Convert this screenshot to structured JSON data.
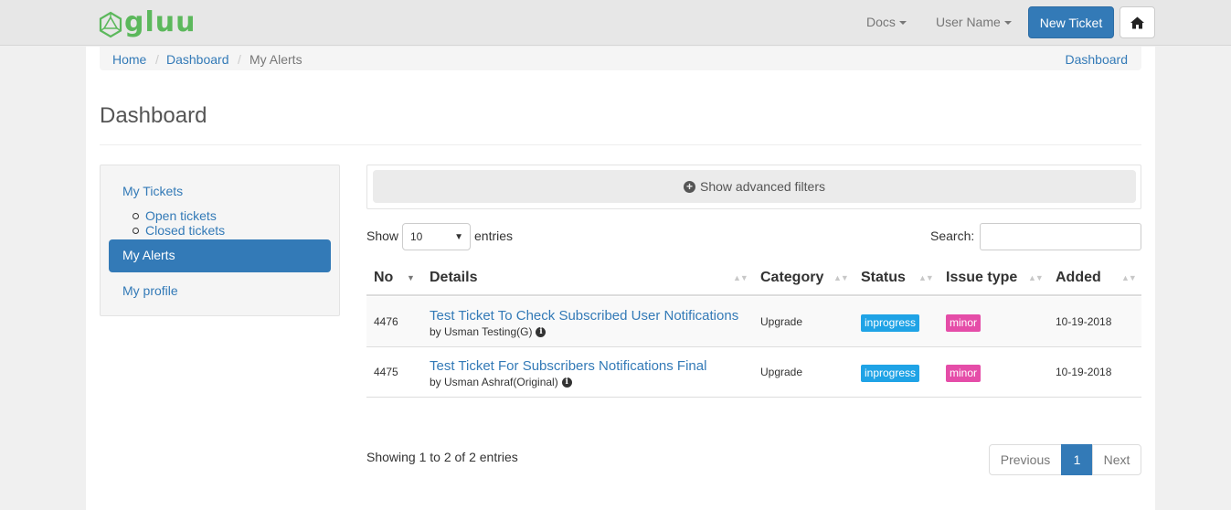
{
  "navbar": {
    "logo_text": "gluu",
    "docs_label": "Docs",
    "user_label": "User Name",
    "new_ticket_label": "New Ticket"
  },
  "breadcrumb": {
    "items": [
      "Home",
      "Dashboard",
      "My Alerts"
    ],
    "separator": "/",
    "right_link": "Dashboard"
  },
  "page": {
    "title": "Dashboard"
  },
  "sidebar": {
    "my_tickets": "My Tickets",
    "sub_items": [
      "Open tickets",
      "Closed tickets"
    ],
    "my_alerts": "My Alerts",
    "my_profile": "My profile"
  },
  "filters": {
    "toggle_label": "Show advanced filters"
  },
  "length": {
    "show_label": "Show",
    "selected": "10",
    "entries_label": "entries"
  },
  "search": {
    "label": "Search:",
    "value": ""
  },
  "table": {
    "columns": [
      "No",
      "Details",
      "Category",
      "Status",
      "Issue type",
      "Added"
    ],
    "rows": [
      {
        "no": "4476",
        "title": "Test Ticket To Check Subscribed User Notifications",
        "by": "by Usman Testing(G)",
        "category": "Upgrade",
        "status": "inprogress",
        "issue_type": "minor",
        "added": "10-19-2018"
      },
      {
        "no": "4475",
        "title": "Test Ticket For Subscribers Notifications Final",
        "by": "by Usman Ashraf(Original)",
        "category": "Upgrade",
        "status": "inprogress",
        "issue_type": "minor",
        "added": "10-19-2018"
      }
    ]
  },
  "footer": {
    "info": "Showing 1 to 2 of 2 entries",
    "previous": "Previous",
    "current_page": "1",
    "next": "Next"
  },
  "colors": {
    "brand_green": "#5cb85c",
    "primary": "#337ab7",
    "status_badge": "#1fa3e6",
    "type_badge": "#e54da8"
  }
}
